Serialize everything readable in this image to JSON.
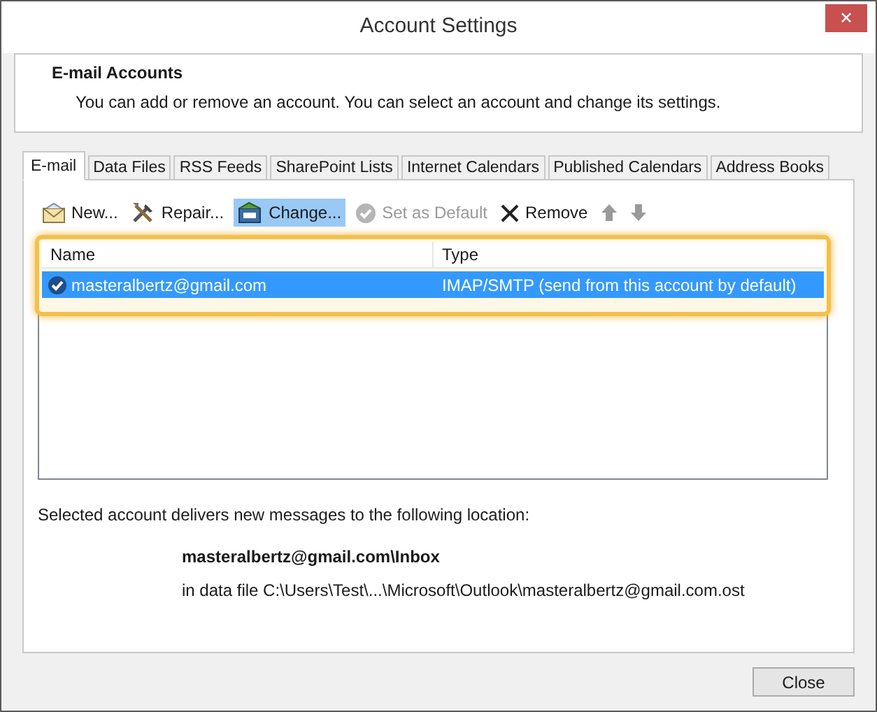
{
  "window": {
    "title": "Account Settings",
    "close_glyph": "✕"
  },
  "header": {
    "title": "E-mail Accounts",
    "description": "You can add or remove an account. You can select an account and change its settings."
  },
  "tabs": [
    {
      "label": "E-mail",
      "selected": true
    },
    {
      "label": "Data Files",
      "selected": false
    },
    {
      "label": "RSS Feeds",
      "selected": false
    },
    {
      "label": "SharePoint Lists",
      "selected": false
    },
    {
      "label": "Internet Calendars",
      "selected": false
    },
    {
      "label": "Published Calendars",
      "selected": false
    },
    {
      "label": "Address Books",
      "selected": false
    }
  ],
  "toolbar": [
    {
      "kind": "new",
      "label": "New...",
      "selected": false,
      "disabled": false
    },
    {
      "kind": "repair",
      "label": "Repair...",
      "selected": false,
      "disabled": false
    },
    {
      "kind": "change",
      "label": "Change...",
      "selected": true,
      "disabled": false
    },
    {
      "kind": "default",
      "label": "Set as Default",
      "selected": false,
      "disabled": true
    },
    {
      "kind": "remove",
      "label": "Remove",
      "selected": false,
      "disabled": false
    },
    {
      "kind": "up",
      "selected": false,
      "disabled": true
    },
    {
      "kind": "down",
      "selected": false,
      "disabled": true
    }
  ],
  "accounts": {
    "highlighted": true,
    "columns": [
      "Name",
      "Type"
    ],
    "rows": [
      {
        "name": "masteralbertz@gmail.com",
        "type": "IMAP/SMTP (send from this account by default)",
        "selected": true,
        "default": true
      }
    ]
  },
  "delivery": {
    "intro": "Selected account delivers new messages to the following location:",
    "folder": "masteralbertz@gmail.com\\Inbox",
    "data_file": "in data file C:\\Users\\Test\\...\\Microsoft\\Outlook\\masteralbertz@gmail.com.ost"
  },
  "buttons": [
    {
      "label": "Close"
    }
  ]
}
